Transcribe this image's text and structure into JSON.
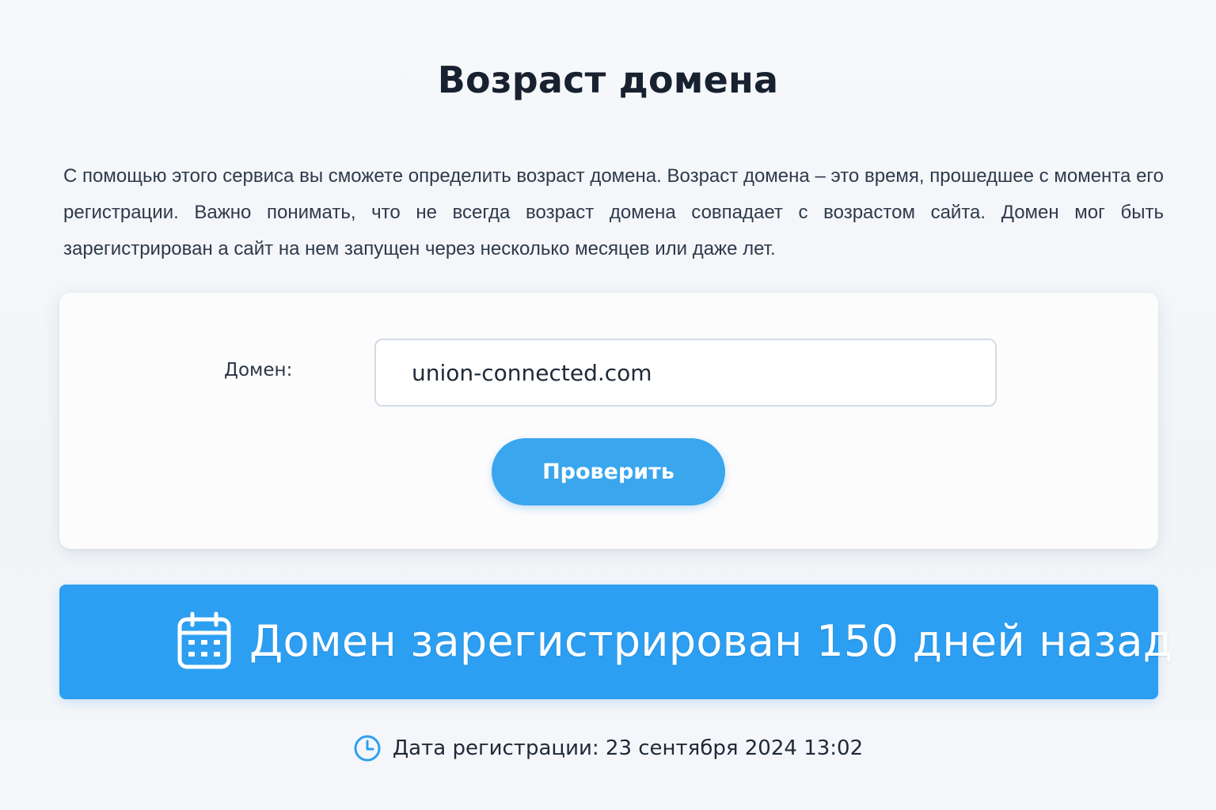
{
  "page": {
    "title": "Возраст домена",
    "description": "С помощью этого сервиса вы сможете определить возраст домена. Возраст домена – это время, прошедшее с момента его регистрации. Важно понимать, что не всегда возраст домена совпадает с возрастом сайта. Домен мог быть зарегистрирован а сайт на нем запущен через несколько месяцев или даже лет."
  },
  "form": {
    "domain_label": "Домен:",
    "domain_value": "union-connected.com",
    "submit_label": "Проверить"
  },
  "result": {
    "icon": "calendar-icon",
    "text": "Домен зарегистрирован 150 дней назад"
  },
  "registration": {
    "icon": "clock-icon",
    "text": "Дата регистрации: 23 сентября 2024 13:02"
  },
  "colors": {
    "accent": "#2d9ff2",
    "button": "#3aa6ee",
    "title": "#17212f"
  }
}
